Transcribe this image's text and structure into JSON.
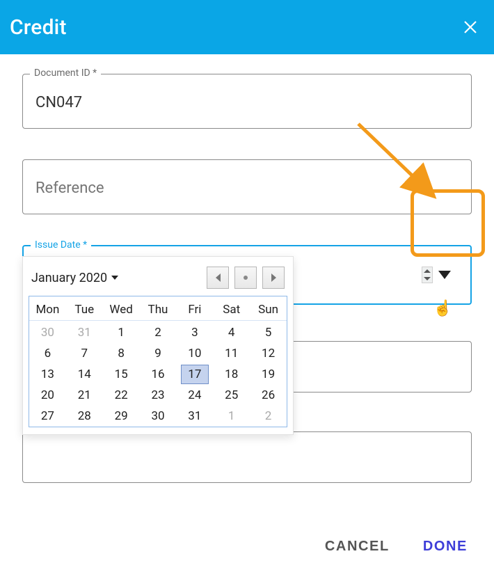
{
  "header": {
    "title": "Credit"
  },
  "fields": {
    "document_id": {
      "label": "Document ID *",
      "value": "CN047"
    },
    "reference": {
      "label": "Reference",
      "value": ""
    },
    "issue_date": {
      "label": "Issue Date *",
      "day": "17",
      "month": "01",
      "year": "2020",
      "sep": "/"
    }
  },
  "datepicker": {
    "month_label": "January 2020",
    "day_names": [
      "Mon",
      "Tue",
      "Wed",
      "Thu",
      "Fri",
      "Sat",
      "Sun"
    ],
    "weeks": [
      [
        {
          "d": "30",
          "muted": true
        },
        {
          "d": "31",
          "muted": true
        },
        {
          "d": "1"
        },
        {
          "d": "2"
        },
        {
          "d": "3"
        },
        {
          "d": "4"
        },
        {
          "d": "5"
        }
      ],
      [
        {
          "d": "6"
        },
        {
          "d": "7"
        },
        {
          "d": "8"
        },
        {
          "d": "9"
        },
        {
          "d": "10"
        },
        {
          "d": "11"
        },
        {
          "d": "12"
        }
      ],
      [
        {
          "d": "13"
        },
        {
          "d": "14"
        },
        {
          "d": "15"
        },
        {
          "d": "16"
        },
        {
          "d": "17",
          "selected": true
        },
        {
          "d": "18"
        },
        {
          "d": "19"
        }
      ],
      [
        {
          "d": "20"
        },
        {
          "d": "21"
        },
        {
          "d": "22"
        },
        {
          "d": "23"
        },
        {
          "d": "24"
        },
        {
          "d": "25"
        },
        {
          "d": "26"
        }
      ],
      [
        {
          "d": "27"
        },
        {
          "d": "28"
        },
        {
          "d": "29"
        },
        {
          "d": "30"
        },
        {
          "d": "31"
        },
        {
          "d": "1",
          "muted": true
        },
        {
          "d": "2",
          "muted": true
        }
      ]
    ]
  },
  "actions": {
    "cancel": "CANCEL",
    "done": "DONE"
  },
  "annotation": {
    "highlight": "dropdown-toggle"
  }
}
